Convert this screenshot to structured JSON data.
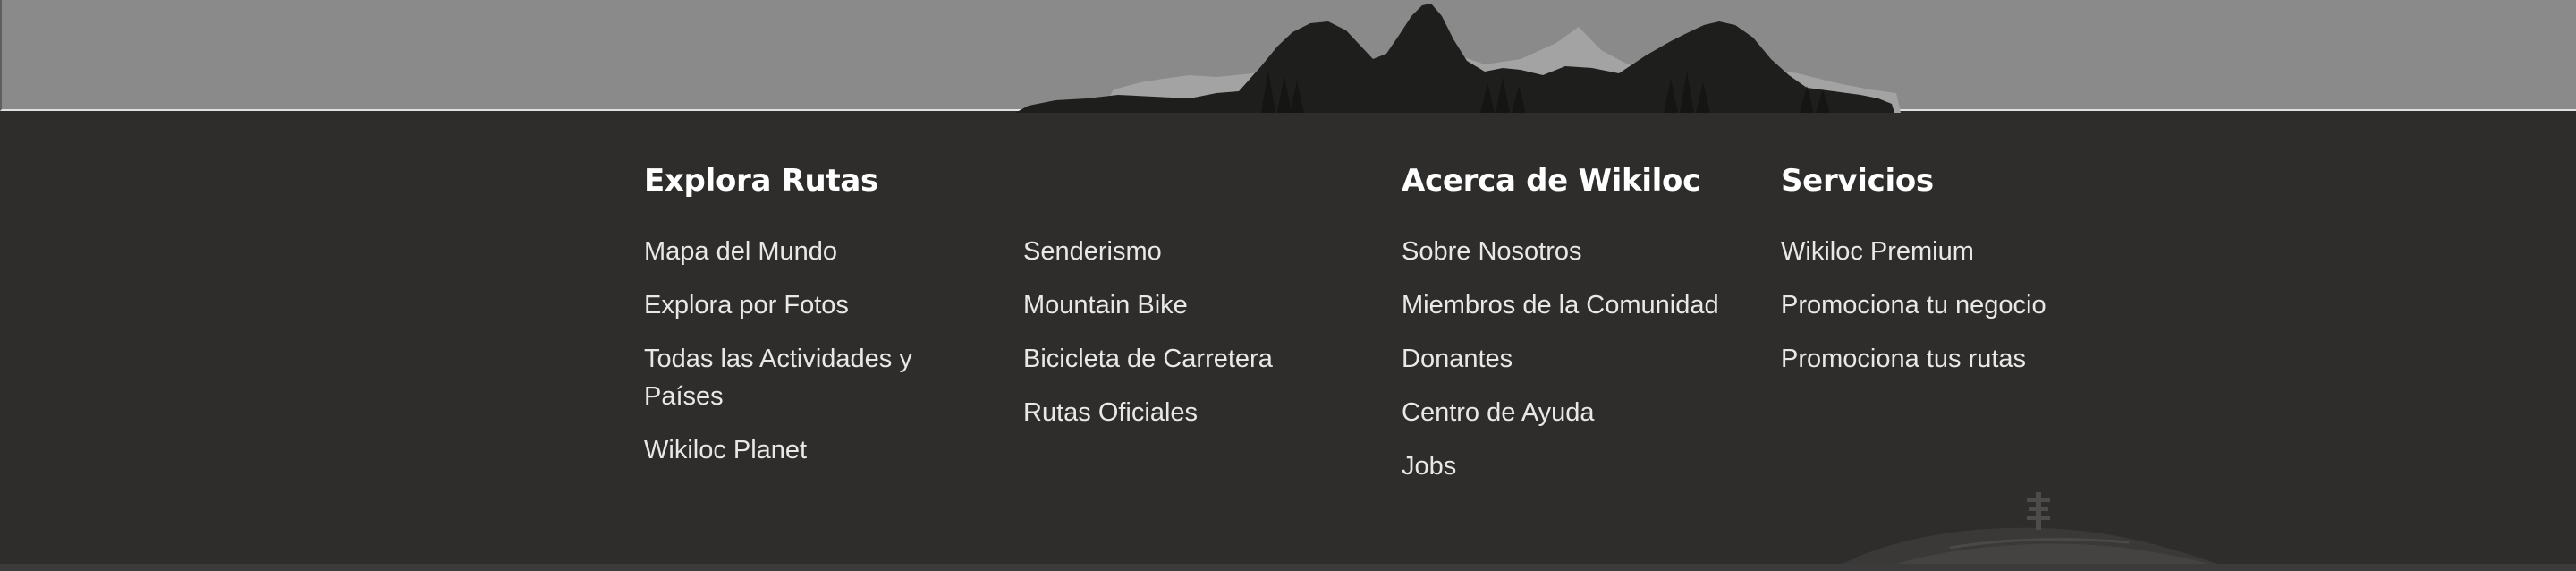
{
  "footer": {
    "columns": [
      {
        "heading": "Explora Rutas",
        "links": [
          "Mapa del Mundo",
          "Explora por Fotos",
          "Todas las Actividades y Países",
          "Wikiloc Planet"
        ]
      },
      {
        "heading": "",
        "links": [
          "Senderismo",
          "Mountain Bike",
          "Bicicleta de Carretera",
          "Rutas Oficiales"
        ]
      },
      {
        "heading": "Acerca de Wikiloc",
        "links": [
          "Sobre Nosotros",
          "Miembros de la Comunidad",
          "Donantes",
          "Centro de Ayuda",
          "Jobs"
        ]
      },
      {
        "heading": "Servicios",
        "links": [
          "Wikiloc Premium",
          "Promociona tu negocio",
          "Promociona tus rutas"
        ]
      }
    ]
  },
  "decor": {
    "sky_color": "#8a8a8a",
    "footer_color": "#2e2d2b",
    "mountain_dark": "#1d1d1b",
    "mountain_light": "#a2a2a2",
    "heading_color": "#ffffff",
    "link_color": "#e8e8e8",
    "icons": [
      "mountain-range-illustration",
      "hill-signpost-illustration"
    ]
  }
}
